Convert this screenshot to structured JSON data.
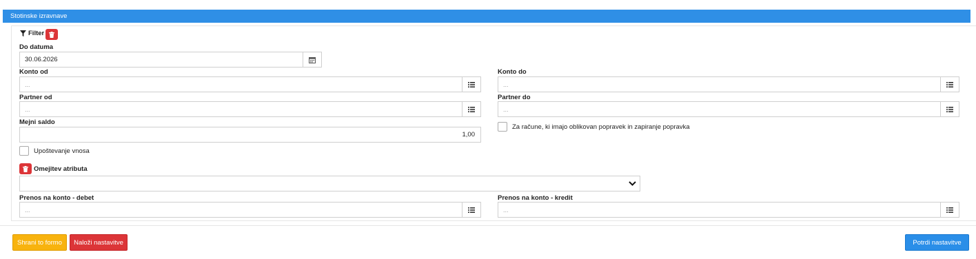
{
  "header": {
    "title": "Stotinske izravnave"
  },
  "filter": {
    "label": "Filter"
  },
  "do_datuma": {
    "label": "Do datuma",
    "value": "30.06.2026"
  },
  "konto_od": {
    "label": "Konto od",
    "placeholder": "..."
  },
  "konto_do": {
    "label": "Konto do",
    "placeholder": "..."
  },
  "partner_od": {
    "label": "Partner od",
    "placeholder": "..."
  },
  "partner_do": {
    "label": "Partner do",
    "placeholder": "..."
  },
  "mejni_saldo": {
    "label": "Mejni saldo",
    "value": "1,00"
  },
  "za_racune": {
    "label": "Za račune, ki imajo oblikovan popravek in zapiranje popravka"
  },
  "upostevanje": {
    "label": "Upoštevanje vnosa"
  },
  "omejitev": {
    "label": "Omejitev atributa",
    "value": ""
  },
  "prenos_debet": {
    "label": "Prenos na konto - debet",
    "placeholder": "..."
  },
  "prenos_kredit": {
    "label": "Prenos na konto - kredit",
    "placeholder": "..."
  },
  "buttons": {
    "save": "Shrani to formo",
    "load": "Naloži nastavitve",
    "confirm": "Potrdi nastavitve"
  },
  "colors": {
    "header": "#2f8fe6",
    "danger": "#dc3538",
    "warning": "#f8b30e",
    "primary": "#2a8ee8"
  },
  "icons": {
    "filter": "filter-icon",
    "trash": "trash-icon",
    "calendar": "calendar-icon",
    "list": "list-icon",
    "chevron": "chevron-down-icon"
  }
}
